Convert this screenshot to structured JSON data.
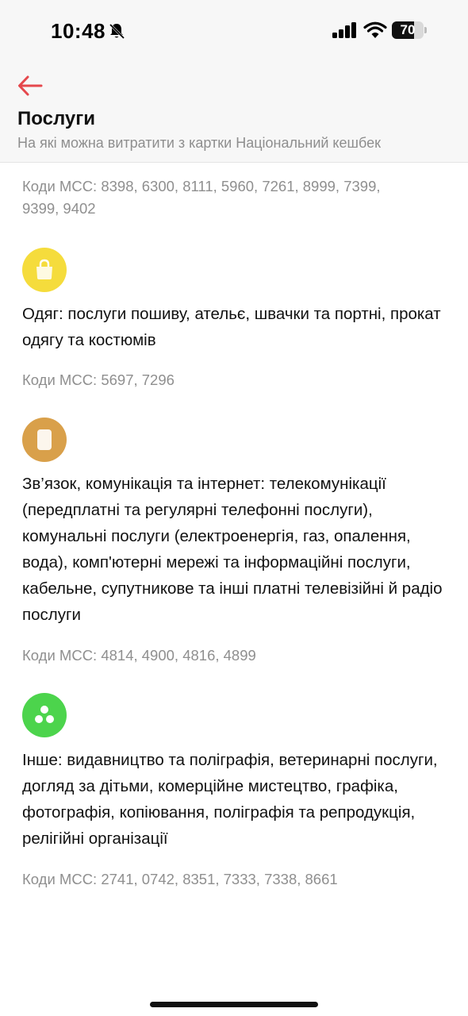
{
  "status_bar": {
    "time": "10:48",
    "battery_level": "70",
    "battery_fraction": 0.7
  },
  "header": {
    "title": "Послуги",
    "subtitle": "На які можна витратити з картки Національний кешбек"
  },
  "colors": {
    "accent": "#e5484d",
    "clothing_icon": "#f5dc3c",
    "communication_icon": "#d9a04a",
    "other_icon": "#4cd44c"
  },
  "items": [
    {
      "mcc": "Коди MCC: 8398, 6300, 8111, 5960, 7261, 8999, 7399, 9399, 9402"
    },
    {
      "icon": "shopping-bag-icon",
      "text": "Одяг: послуги пошиву, ательє, швачки та портні, прокат одягу та костюмів",
      "mcc": "Коди MCC: 5697, 7296"
    },
    {
      "icon": "phone-icon",
      "text": "Зв’язок, комунікація та інтернет: телекомунікації (передплатні та регулярні телефонні послуги), комунальні послуги (електроенергія, газ, опалення, вода), комп'ютерні мережі та інформаційні послуги, кабельне, супутникове та інші платні телевізійні й радіо послуги",
      "mcc": "Коди MCC: 4814, 4900, 4816, 4899"
    },
    {
      "icon": "three-dots-icon",
      "text": "Інше: видавництво та поліграфія, ветеринарні послуги, догляд за дітьми, комерційне мистецтво, графіка, фотографія, копіювання, поліграфія та репродукція, релігійні організації",
      "mcc": "Коди MCC: 2741, 0742, 8351, 7333, 7338, 8661"
    }
  ]
}
